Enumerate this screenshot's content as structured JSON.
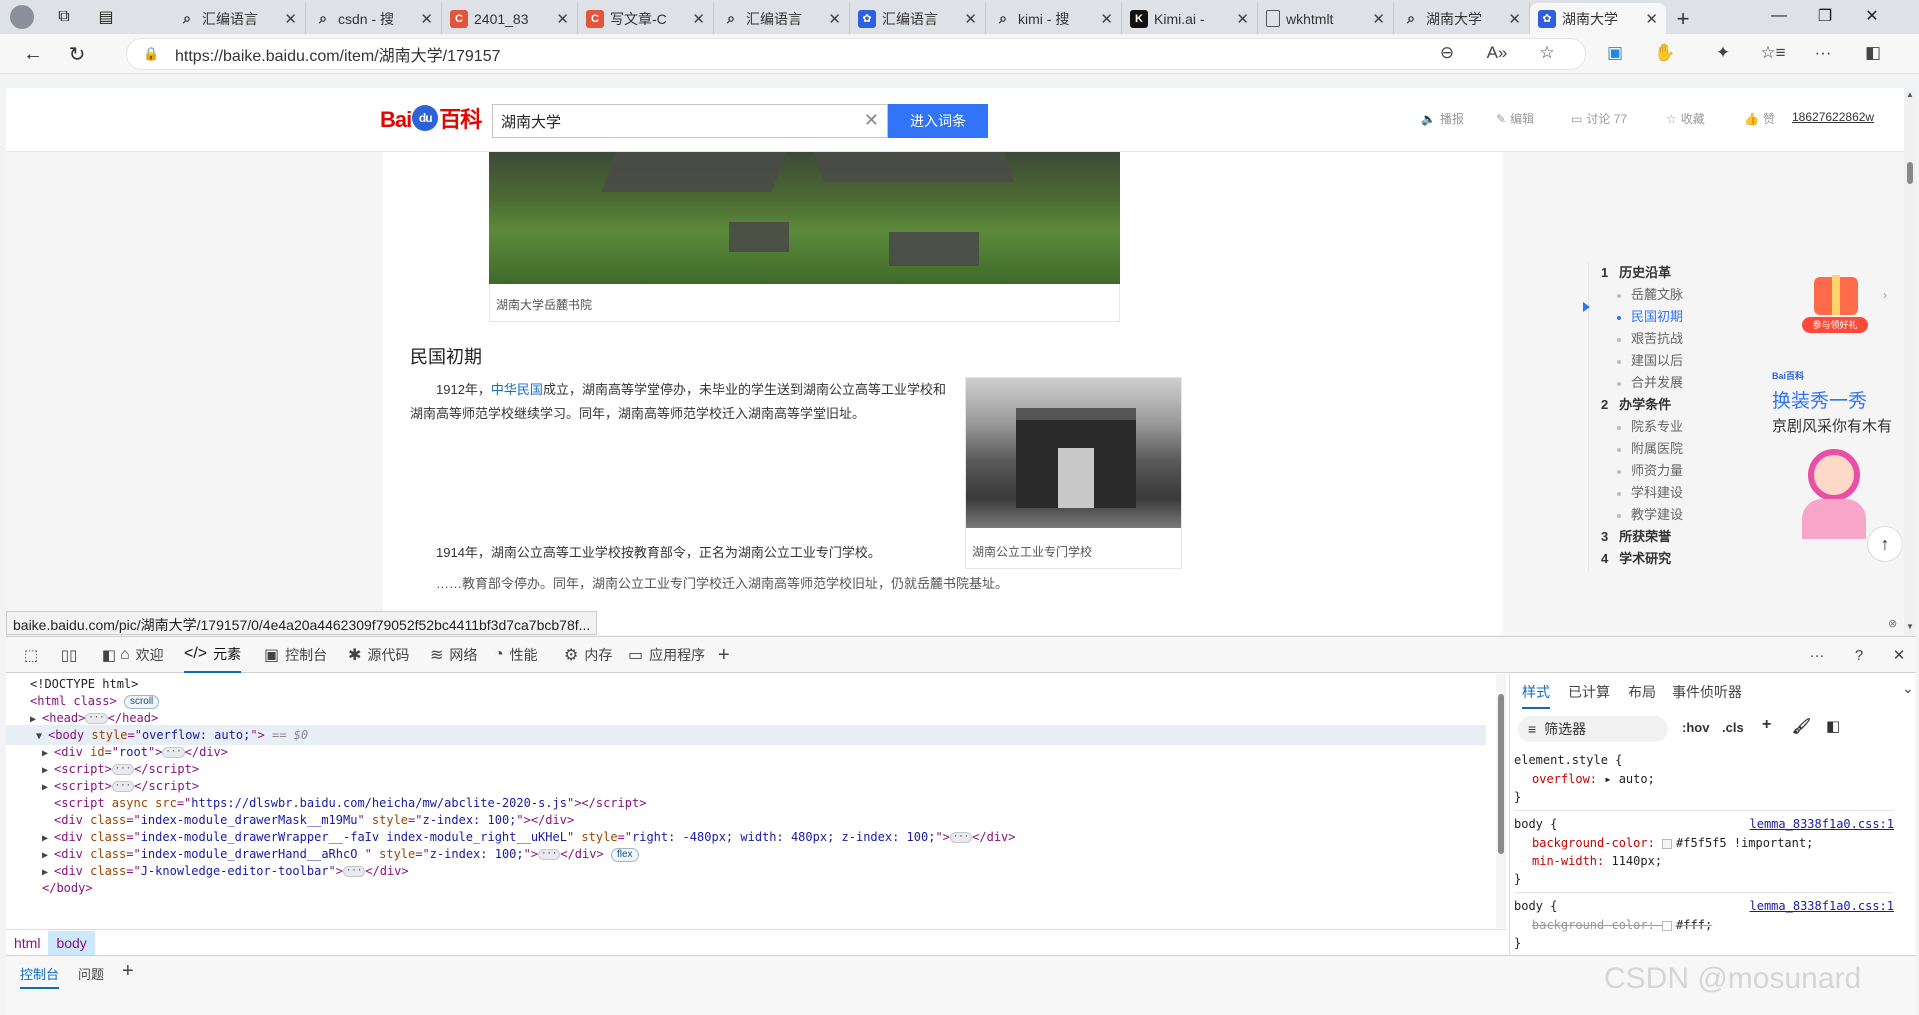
{
  "browser": {
    "tabs": [
      {
        "title": "汇编语言",
        "favicon": "search",
        "active": false
      },
      {
        "title": "csdn - 搜",
        "favicon": "search",
        "active": false
      },
      {
        "title": "2401_83",
        "favicon": "csdn",
        "active": false
      },
      {
        "title": "写文章-C",
        "favicon": "csdn",
        "active": false
      },
      {
        "title": "汇编语言",
        "favicon": "search",
        "active": false
      },
      {
        "title": "汇编语言",
        "favicon": "baidu",
        "active": false
      },
      {
        "title": "kimi - 搜",
        "favicon": "search",
        "active": false
      },
      {
        "title": "Kimi.ai -",
        "favicon": "kimi",
        "active": false
      },
      {
        "title": "wkhtmlt",
        "favicon": "doc",
        "active": false
      },
      {
        "title": "湖南大学",
        "favicon": "search",
        "active": false
      },
      {
        "title": "湖南大学",
        "favicon": "baidu",
        "active": true
      }
    ],
    "url": "https://baike.baidu.com/item/湖南大学/179157",
    "status_link": "baike.baidu.com/pic/湖南大学/179157/0/4e4a20a4462309f79052f52bc4411bf3d7ca7bcb78f..."
  },
  "baike": {
    "logo_text": "Bai百科",
    "logo_du": "du",
    "search_value": "湖南大学",
    "enter_button": "进入词条",
    "actions": {
      "play": "播报",
      "edit": "编辑",
      "discuss": "讨论 77",
      "collect": "收藏",
      "like": "赞",
      "user": "18627622862w"
    },
    "hero_caption": "湖南大学岳麓书院",
    "section_title": "民国初期",
    "para1_link": "中华民国",
    "para1_before": "1912年，",
    "para1_after": "成立，湖南高等学堂停办，未毕业的学生送到湖南公立高等工业学校和湖南高等师范学校继续学习。同年，湖南高等师范学校迁入湖南高等学堂旧址。",
    "para2": "1914年，湖南公立高等工业学校按教育部令，正名为湖南公立工业专门学校。",
    "para3": "……教育部令停办。同年，湖南公立工业专门学校迁入湖南高等师范学校旧址，仍就岳麓书院基址。",
    "photo_caption": "湖南公立工业专门学校",
    "toc": [
      {
        "num": "1",
        "label": "历史沿革",
        "type": "h"
      },
      {
        "label": "岳麓文脉",
        "type": "i"
      },
      {
        "label": "民国初期",
        "type": "i",
        "active": true
      },
      {
        "label": "艰苦抗战",
        "type": "i"
      },
      {
        "label": "建国以后",
        "type": "i"
      },
      {
        "label": "合并发展",
        "type": "i"
      },
      {
        "num": "2",
        "label": "办学条件",
        "type": "h"
      },
      {
        "label": "院系专业",
        "type": "i"
      },
      {
        "label": "附属医院",
        "type": "i"
      },
      {
        "label": "师资力量",
        "type": "i"
      },
      {
        "label": "学科建设",
        "type": "i"
      },
      {
        "label": "教学建设",
        "type": "i"
      },
      {
        "num": "3",
        "label": "所获荣誉",
        "type": "h"
      },
      {
        "num": "4",
        "label": "学术研究",
        "type": "h"
      }
    ],
    "gift_label": "参与领好礼",
    "promo": {
      "brand": "Bai百科",
      "title": "换装秀一秀",
      "subtitle": "京剧风采你有木有"
    }
  },
  "devtools": {
    "tabs": [
      {
        "icon": "home-icon",
        "glyph": "⌂",
        "label": "欢迎"
      },
      {
        "icon": "code-icon",
        "glyph": "</>",
        "label": "元素",
        "active": true
      },
      {
        "icon": "console-icon",
        "glyph": "▣",
        "label": "控制台"
      },
      {
        "icon": "bug-icon",
        "glyph": "✱",
        "label": "源代码"
      },
      {
        "icon": "wifi-icon",
        "glyph": "≋",
        "label": "网络"
      },
      {
        "icon": "performance-icon",
        "glyph": "◔",
        "label": "性能"
      },
      {
        "icon": "memory-icon",
        "glyph": "⚙",
        "label": "内存"
      },
      {
        "icon": "application-icon",
        "glyph": "▭",
        "label": "应用程序"
      }
    ],
    "dom": {
      "doctype": "<!DOCTYPE html>",
      "html_open": "<html class>",
      "html_badge": "scroll",
      "head": "head",
      "body_style": "overflow: auto;",
      "body_sel": "== $0",
      "root_id": "root",
      "script_src": "https://dlswbr.baidu.com/heicha/mw/abclite-2020-s.js",
      "div_mask_class": "index-module_drawerMask__m19Mu",
      "div_mask_style": "z-index: 100;",
      "div_wrap_class": "index-module_drawerWrapper__-faIv index-module_right__uKHeL",
      "div_wrap_style": "right: -480px; width: 480px; z-index: 100;",
      "div_hand_class": "index-module_drawerHand__aRhcO ",
      "div_hand_style": "z-index: 100;",
      "div_hand_badge": "flex",
      "div_toolbar_class": "J-knowledge-editor-toolbar",
      "body_close": "</body>"
    },
    "breadcrumbs": [
      "html",
      "body"
    ],
    "styles_tabs": [
      "样式",
      "已计算",
      "布局",
      "事件侦听器"
    ],
    "filter_placeholder": "筛选器",
    "hov": ":hov",
    "cls": ".cls",
    "rules": [
      {
        "selector": "element.style {",
        "props": [
          {
            "name": "overflow",
            "value": "▸ auto;"
          }
        ]
      },
      {
        "selector": "body {",
        "source": "lemma_8338f1a0.css:1",
        "props": [
          {
            "name": "background-color",
            "value": "#f5f5f5 !important;",
            "swatch": "#f5f5f5"
          },
          {
            "name": "min-width",
            "value": "1140px;"
          }
        ]
      },
      {
        "selector": "body {",
        "source": "lemma_8338f1a0.css:1",
        "props": [
          {
            "name": "background-color",
            "value": "#fff;",
            "swatch": "#ffffff",
            "strike": true
          }
        ]
      }
    ],
    "drawer_tabs": [
      "控制台",
      "问题"
    ]
  },
  "watermark": "CSDN @mosunard",
  "colors": {
    "baidu_blue": "#3174f8",
    "baidu_red": "#e10602",
    "devtools_accent": "#0f6cbd",
    "link": "#136ec2"
  }
}
